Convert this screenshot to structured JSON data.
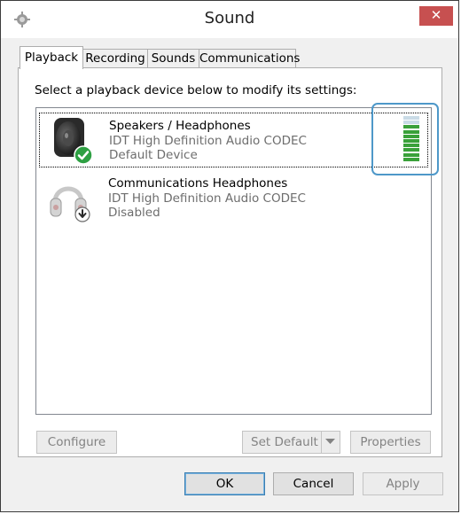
{
  "window": {
    "title": "Sound",
    "close_glyph": "✕"
  },
  "tabs": [
    {
      "label": "Playback",
      "active": true
    },
    {
      "label": "Recording",
      "active": false
    },
    {
      "label": "Sounds",
      "active": false
    },
    {
      "label": "Communications",
      "active": false
    }
  ],
  "playback": {
    "instruction": "Select a playback device below to modify its settings:",
    "devices": [
      {
        "name": "Speakers / Headphones",
        "driver": "IDT High Definition Audio CODEC",
        "status": "Default Device",
        "icon": "speaker-icon",
        "badge": "default-check-icon",
        "selected": true,
        "level": 0.75
      },
      {
        "name": "Communications Headphones",
        "driver": "IDT High Definition Audio CODEC",
        "status": "Disabled",
        "icon": "headphones-icon",
        "badge": "disabled-arrow-icon",
        "selected": false
      }
    ],
    "buttons": {
      "configure": "Configure",
      "set_default": "Set Default",
      "properties": "Properties"
    }
  },
  "dialog_buttons": {
    "ok": "OK",
    "cancel": "Cancel",
    "apply": "Apply"
  },
  "colors": {
    "accent_highlight": "#4e98c9",
    "meter_active": "#3aa13a",
    "meter_inactive": "#c9dbe6",
    "check_green": "#2ea043"
  }
}
